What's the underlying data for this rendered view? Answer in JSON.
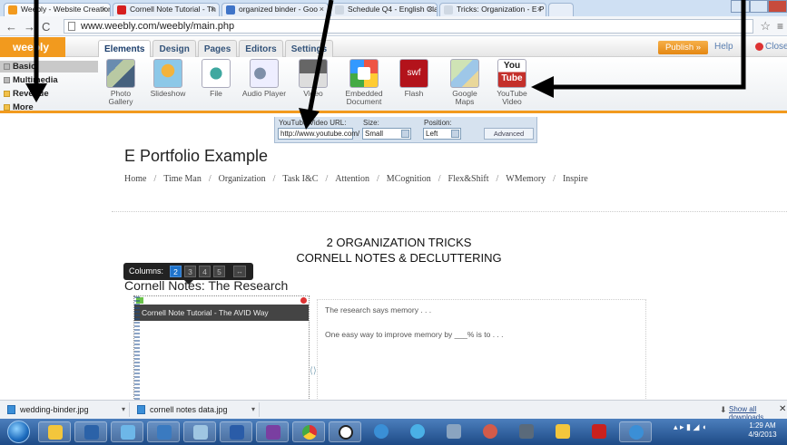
{
  "browser": {
    "tabs": [
      {
        "label": "Weebly - Website Creation",
        "fav": "#f29a1e"
      },
      {
        "label": "Cornell Note Tutorial - Th",
        "fav": "#d61f1f"
      },
      {
        "label": "organized binder - Goo",
        "fav": "#3f74c8"
      },
      {
        "label": "Schedule Q4 - English Cla",
        "fav": "#cfd8e3"
      },
      {
        "label": "Tricks: Organization - E P",
        "fav": "#cfd8e3"
      }
    ],
    "url": "www.weebly.com/weebly/main.php"
  },
  "weebly": {
    "logo": "weebly",
    "tabs": [
      "Elements",
      "Design",
      "Pages",
      "Editors",
      "Settings"
    ],
    "publish_label": "Publish »",
    "help_label": "Help",
    "close_label": "Close",
    "categories": [
      "Basic",
      "Multimedia",
      "Revenue",
      "More"
    ],
    "elements": [
      {
        "label": "Photo Gallery",
        "icon": "photo-gallery-icon"
      },
      {
        "label": "Slideshow",
        "icon": "slideshow-icon"
      },
      {
        "label": "File",
        "icon": "file-icon"
      },
      {
        "label": "Audio Player",
        "icon": "audio-player-icon"
      },
      {
        "label": "Video",
        "icon": "video-icon"
      },
      {
        "label": "Embedded Document",
        "icon": "embedded-document-icon"
      },
      {
        "label": "Flash",
        "icon": "flash-icon"
      },
      {
        "label": "Google Maps",
        "icon": "google-maps-icon"
      },
      {
        "label": "YouTube Video",
        "icon": "youtube-icon"
      }
    ],
    "youtube_settings": {
      "url_label": "YouTube Video URL:",
      "url_value": "http://www.youtube.com/",
      "size_label": "Size:",
      "size_value": "Small",
      "position_label": "Position:",
      "position_value": "Left",
      "advanced_label": "Advanced"
    }
  },
  "site": {
    "title": "E Portfolio Example",
    "nav": [
      "Home",
      "Time Man",
      "Organization",
      "Task I&C",
      "Attention",
      "MCognition",
      "Flex&Shift",
      "WMemory",
      "Inspire"
    ],
    "heading1": "2 ORGANIZATION TRICKS",
    "heading2": "CORNELL NOTES & DECLUTTERING",
    "columns_label": "Columns:",
    "column_options": [
      "2",
      "3",
      "4",
      "5"
    ],
    "section_title": "Cornell Notes: The Research",
    "video_title": "Cornell Note Tutorial - The AVID Way",
    "paragraph1": "The research says memory . . .",
    "paragraph2": "One easy way to improve memory by ___% is to . . ."
  },
  "downloads": {
    "items": [
      "wedding-binder.jpg",
      "cornell notes data.jpg"
    ],
    "show_all": "Show all downloads..."
  },
  "taskbar": {
    "clock_time": "1:29 AM",
    "clock_date": "4/9/2013"
  }
}
